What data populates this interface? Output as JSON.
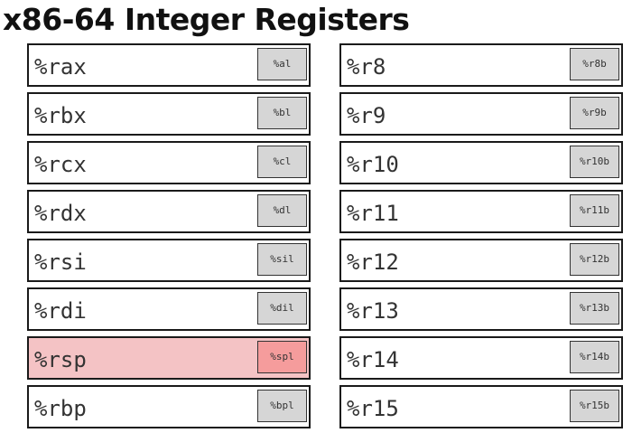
{
  "title": "x86-64 Integer Registers",
  "colors": {
    "highlight_bg": "#f4c3c5",
    "highlight_sub_bg": "#f59c9c",
    "sub_bg": "#d6d6d6",
    "border": "#1a1a1a"
  },
  "left_registers": [
    {
      "name": "%rax",
      "sub": "%al",
      "highlighted": false
    },
    {
      "name": "%rbx",
      "sub": "%bl",
      "highlighted": false
    },
    {
      "name": "%rcx",
      "sub": "%cl",
      "highlighted": false
    },
    {
      "name": "%rdx",
      "sub": "%dl",
      "highlighted": false
    },
    {
      "name": "%rsi",
      "sub": "%sil",
      "highlighted": false
    },
    {
      "name": "%rdi",
      "sub": "%dil",
      "highlighted": false
    },
    {
      "name": "%rsp",
      "sub": "%spl",
      "highlighted": true
    },
    {
      "name": "%rbp",
      "sub": "%bpl",
      "highlighted": false
    }
  ],
  "right_registers": [
    {
      "name": "%r8",
      "sub": "%r8b",
      "highlighted": false
    },
    {
      "name": "%r9",
      "sub": "%r9b",
      "highlighted": false
    },
    {
      "name": "%r10",
      "sub": "%r10b",
      "highlighted": false
    },
    {
      "name": "%r11",
      "sub": "%r11b",
      "highlighted": false
    },
    {
      "name": "%r12",
      "sub": "%r12b",
      "highlighted": false
    },
    {
      "name": "%r13",
      "sub": "%r13b",
      "highlighted": false
    },
    {
      "name": "%r14",
      "sub": "%r14b",
      "highlighted": false
    },
    {
      "name": "%r15",
      "sub": "%r15b",
      "highlighted": false
    }
  ]
}
